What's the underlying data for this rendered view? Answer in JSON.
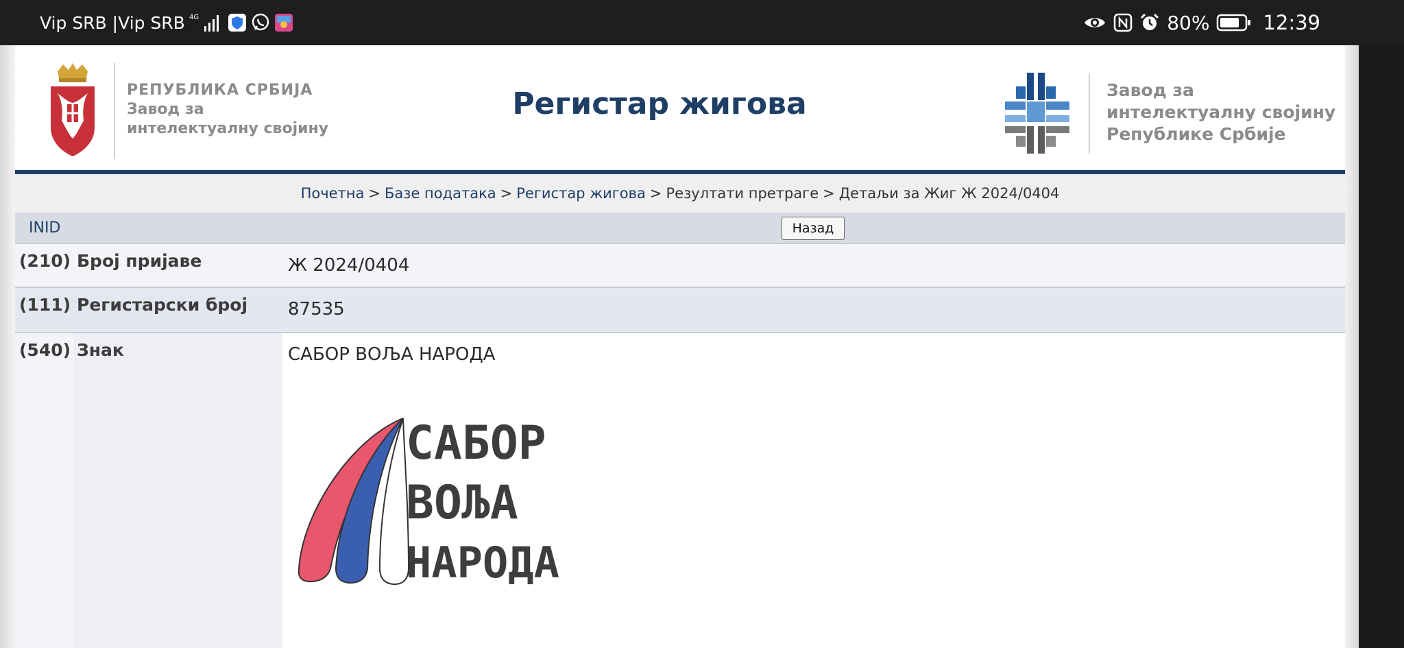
{
  "status_bar": {
    "carrier": "Vip SRB |Vip SRB",
    "network": "4G",
    "battery_pct": "80%",
    "time": "12:39",
    "icons": [
      "signal-icon",
      "shield-app-icon",
      "viber-icon",
      "game-app-icon",
      "eye-icon",
      "nfc-icon",
      "alarm-icon",
      "battery-icon"
    ]
  },
  "header": {
    "org_left": [
      "РЕПУБЛИКА СРБИЈА",
      "Завод за",
      "интелектуалну својину"
    ],
    "title": "Регистар жигова",
    "org_right": [
      "Завод за",
      "интелектуалну својину",
      "Републике Србије"
    ]
  },
  "breadcrumb": {
    "items": [
      "Почетна",
      "Базе података",
      "Регистар жигова",
      "Резултати претраге",
      "Детаљи за Жиг Ж 2024/0404"
    ],
    "separator": ">"
  },
  "inid_bar": {
    "label": "INID",
    "back_button": "Назад"
  },
  "rows": [
    {
      "code": "(210)",
      "label": "Број пријаве",
      "value": "Ж 2024/0404"
    },
    {
      "code": "(111)",
      "label": "Регистарски број",
      "value": "87535"
    },
    {
      "code": "(540)",
      "label": "Знак",
      "value": "САБОР ВОЉА НАРОДА"
    }
  ],
  "mark_image": {
    "lines": [
      "САБОР",
      "ВОЉА",
      "НАРОДА"
    ],
    "colors": {
      "red": "#e8576e",
      "blue": "#3b5fb0",
      "white": "#ffffff",
      "text": "#3d3d3d"
    }
  },
  "colors": {
    "navy": "#1f3e66",
    "gray_text": "#8b8b8b",
    "statusbar": "#1e1e1e"
  }
}
